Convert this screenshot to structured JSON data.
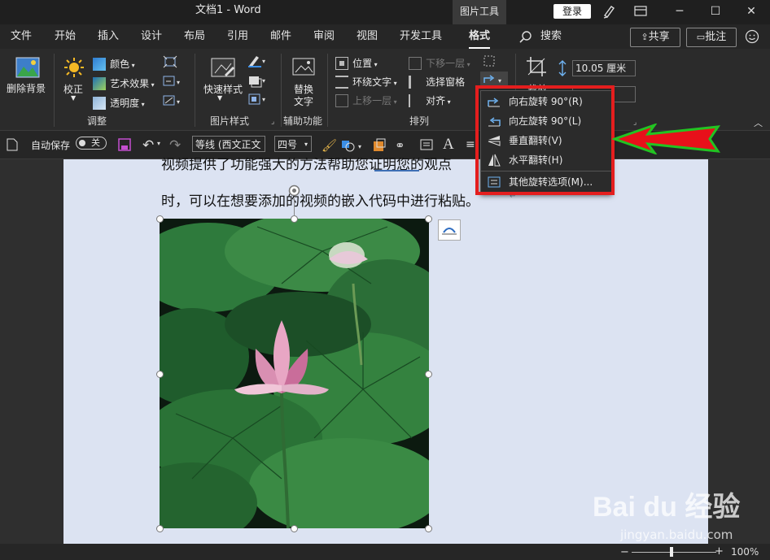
{
  "titlebar": {
    "doc_title": "文档1  -  Word",
    "context_tab": "图片工具",
    "login": "登录"
  },
  "menu": {
    "items": [
      "文件",
      "开始",
      "插入",
      "设计",
      "布局",
      "引用",
      "邮件",
      "审阅",
      "视图",
      "开发工具",
      "格式"
    ],
    "search": "搜索",
    "share": "共享",
    "comment": "批注"
  },
  "ribbon": {
    "remove_bg": "删除背景",
    "correct": "校正",
    "color": "颜色",
    "art_effect": "艺术效果",
    "transparency": "透明度",
    "group_adjust": "调整",
    "quick_styles": "快速样式",
    "group_pic_styles": "图片样式",
    "alt_text": "替换\n文字",
    "alt_text_l1": "替换",
    "alt_text_l2": "文字",
    "group_accessibility": "辅助功能",
    "position": "位置",
    "wrap_text": "环绕文字",
    "bring_forward": "上移一层",
    "send_backward": "下移一层",
    "selection_pane": "选择窗格",
    "align": "对齐",
    "group_arrange": "排列",
    "crop": "裁剪",
    "height_value": "10.05 厘米"
  },
  "qat": {
    "autosave": "自动保存",
    "toggle": "关",
    "font_name": "等线 (西文正文",
    "font_size": "四号"
  },
  "document": {
    "line1": "视频提供了功能强大的方法帮助您证明您的观点",
    "line2": "时，可以在想要添加的视频的嵌入代码中进行粘贴。"
  },
  "rotate_menu": {
    "items": [
      "向右旋转 90°(R)",
      "向左旋转 90°(L)",
      "垂直翻转(V)",
      "水平翻转(H)",
      "其他旋转选项(M)..."
    ]
  },
  "status": {
    "zoom": "100%"
  },
  "watermark": {
    "brand": "Bai du 经验",
    "url": "jingyan.baidu.com"
  },
  "colors": {
    "highlight": "#e41e1e",
    "arrow_fill": "#e8101a",
    "arrow_stroke": "#22c322",
    "page": "#dce3f2"
  }
}
